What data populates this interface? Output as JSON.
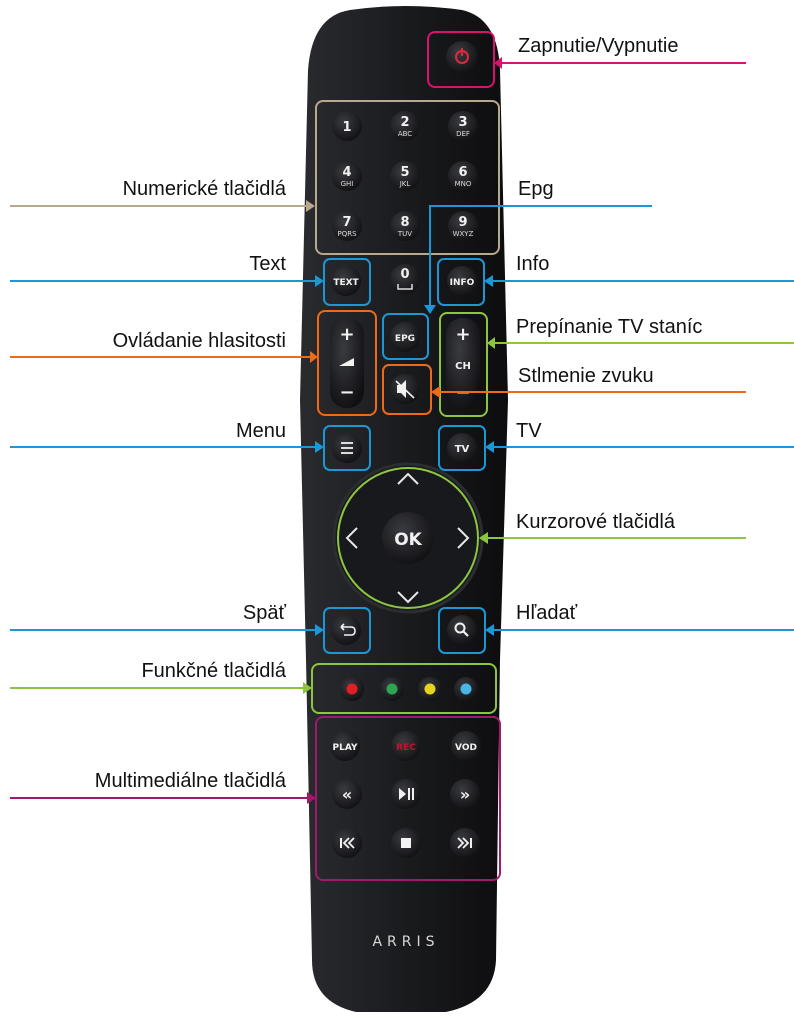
{
  "remote": {
    "brand": "ARRIS",
    "keys": {
      "n1": "1",
      "n2": "2",
      "n2s": "ABC",
      "n3": "3",
      "n3s": "DEF",
      "n4": "4",
      "n4s": "GHI",
      "n5": "5",
      "n5s": "JKL",
      "n6": "6",
      "n6s": "MNO",
      "n7": "7",
      "n7s": "PQRS",
      "n8": "8",
      "n8s": "TUV",
      "n9": "9",
      "n9s": "WXYZ",
      "n0": "0",
      "text": "TEXT",
      "info": "INFO",
      "epg": "EPG",
      "vol_plus": "+",
      "vol_minus": "−",
      "ch": "CH",
      "ch_plus": "+",
      "ch_minus": "−",
      "ok": "OK",
      "play": "PLAY",
      "rec": "REC",
      "vod": "VOD"
    },
    "color_buttons": [
      "#e01e25",
      "#2ea44f",
      "#e8d21f",
      "#47b6e6"
    ]
  },
  "labels": {
    "power": "Zapnutie/Vypnutie",
    "numeric": "Numerické tlačidlá",
    "epg": "Epg",
    "text": "Text",
    "info": "Info",
    "volume": "Ovládanie hlasitosti",
    "channel": "Prepínanie TV staníc",
    "mute": "Stlmenie zvuku",
    "menu": "Menu",
    "tv": "TV",
    "cursor": "Kurzorové tlačidlá",
    "back": "Späť",
    "search": "Hľadať",
    "function": "Funkčné tlačidlá",
    "multimedia": "Multimediálne tlačidlá"
  },
  "colors": {
    "power": "#d6136f",
    "numeric": "#b9a78e",
    "blue": "#1b97d4",
    "orange": "#ef6a17",
    "green": "#8cc63f",
    "magenta": "#a0196e",
    "remote": "#1b1c1f"
  }
}
